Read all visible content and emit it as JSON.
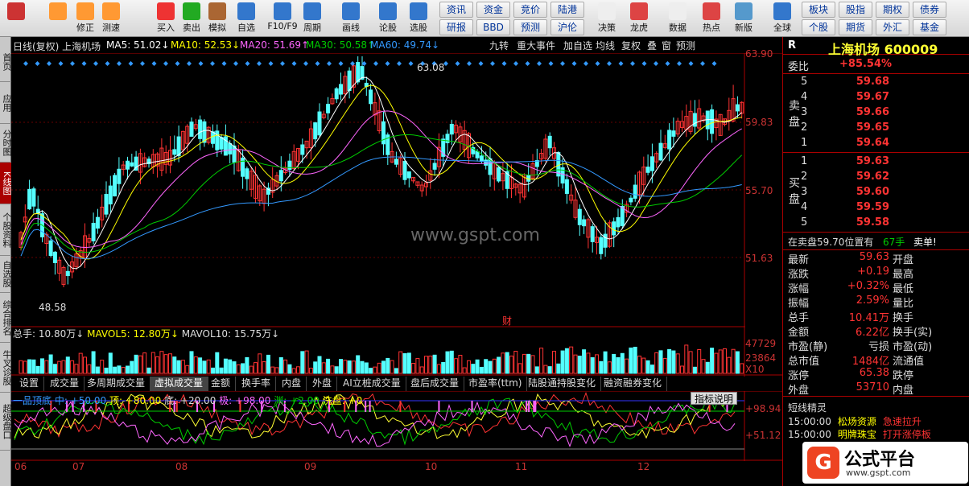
{
  "toolbar": {
    "left_buttons": [
      {
        "label": "",
        "icon": "grid-icon"
      },
      {
        "label": "",
        "icon": "back-arrow-icon"
      },
      {
        "label": "修正",
        "icon": "up-arrow-icon"
      },
      {
        "label": "测速",
        "icon": "smile-icon"
      },
      {
        "label": "买入",
        "icon": "buy-icon"
      },
      {
        "label": "卖出",
        "icon": "sell-icon"
      },
      {
        "label": "模拟",
        "icon": "hammer-icon"
      },
      {
        "label": "自选",
        "icon": "house-icon"
      },
      {
        "label": "F10/F9",
        "icon": "f10-icon"
      },
      {
        "label": "周期",
        "icon": "clock-icon"
      },
      {
        "label": "画线",
        "icon": "pencil-icon"
      },
      {
        "label": "论股",
        "icon": "chat-icon"
      },
      {
        "label": "选股",
        "icon": "chart-icon"
      }
    ],
    "grid1": [
      [
        "资讯",
        "资金",
        "竞价",
        "陆港"
      ],
      [
        "研报",
        "BBD",
        "预测",
        "沪伦"
      ]
    ],
    "mid_buttons": [
      {
        "label": "决策",
        "icon": "decision-icon"
      },
      {
        "label": "龙虎",
        "icon": "dragon-icon"
      },
      {
        "label": "数据",
        "icon": "pe-icon"
      },
      {
        "label": "热点",
        "icon": "hot-icon"
      },
      {
        "label": "新版",
        "icon": "new-icon"
      },
      {
        "label": "全球",
        "icon": "globe-icon"
      }
    ],
    "grid2": [
      [
        "板块",
        "股指",
        "期权",
        "债券"
      ],
      [
        "个股",
        "期货",
        "外汇",
        "基金"
      ]
    ]
  },
  "left_tabs": [
    "首页",
    "应用",
    "分时图",
    "K线图",
    "个股资料",
    "自选股",
    "综合排名",
    "牛叉诊股",
    "超级盘口"
  ],
  "chart_header": {
    "title": "日线(复权) 上海机场",
    "ma5": "MA5: 51.02↓",
    "ma10": "MA10: 52.53↓",
    "ma20": "MA20: 51.69↑",
    "ma30": "MA30: 50.58↑",
    "ma60": "MA60: 49.74↓",
    "right_buttons": [
      "九转",
      "重大事件",
      "加自选",
      "均线",
      "复权",
      "叠",
      "窗",
      "预测"
    ]
  },
  "price_axis": [
    "63.90",
    "59.83",
    "55.70",
    "51.63"
  ],
  "annotations": {
    "high": "63.08",
    "low": "48.58",
    "fin": "财"
  },
  "watermark": "www.gspt.com",
  "volume": {
    "text1": "总手: 10.80万↓",
    "text2": "MAVOL5: 12.80万↓",
    "text3": "MAVOL10: 15.75万↓",
    "axis": [
      "47729",
      "23864",
      "X10"
    ]
  },
  "indicator_tabs": [
    "设置",
    "成交量",
    "多周期成交量",
    "虚拟成交量",
    "金额",
    "换手率",
    "内盘",
    "外盘",
    "AI立桩成交量",
    "盘后成交量",
    "市盈率(ttm)",
    "陆股通持股变化",
    "融资融券变化"
  ],
  "indicator": {
    "name": "一品顶底",
    "t1": "中: +50.00",
    "t2": "顶: +80.00",
    "t3": "底: +20.00",
    "t4": "极: +98.00",
    "t5": "渊: +2.00",
    "t6": "洗盘: +0",
    "help": "指标说明",
    "axis": [
      "+98.94",
      "+51.12"
    ]
  },
  "x_axis": [
    "06",
    "07",
    "08",
    "09",
    "10",
    "11",
    "12"
  ],
  "panel": {
    "r": "R",
    "name": "上海机场 600009",
    "weibi_label": "委比",
    "weibi": "+85.54%",
    "sell_label": "卖盘",
    "buy_label": "买盘",
    "sell": [
      {
        "lv": "5",
        "p": "59.68"
      },
      {
        "lv": "4",
        "p": "59.67"
      },
      {
        "lv": "3",
        "p": "59.66"
      },
      {
        "lv": "2",
        "p": "59.65"
      },
      {
        "lv": "1",
        "p": "59.64"
      }
    ],
    "buy": [
      {
        "lv": "1",
        "p": "59.63"
      },
      {
        "lv": "2",
        "p": "59.62"
      },
      {
        "lv": "3",
        "p": "59.60"
      },
      {
        "lv": "4",
        "p": "59.59"
      },
      {
        "lv": "5",
        "p": "59.58"
      }
    ],
    "tick": "在卖盘59.70位置有",
    "tick_hand": "67手",
    "tick_side": "卖单!",
    "quotes": [
      {
        "k": "最新",
        "v": "59.63",
        "k2": "开盘"
      },
      {
        "k": "涨跌",
        "v": "+0.19",
        "k2": "最高"
      },
      {
        "k": "涨幅",
        "v": "+0.32%",
        "k2": "最低"
      },
      {
        "k": "振幅",
        "v": "2.59%",
        "k2": "量比"
      },
      {
        "k": "总手",
        "v": "10.41万",
        "k2": "换手"
      },
      {
        "k": "金额",
        "v": "6.22亿",
        "k2": "换手(实)"
      },
      {
        "k": "市盈(静)",
        "v": "亏损",
        "k2": "市盈(动)"
      },
      {
        "k": "总市值",
        "v": "1484亿",
        "k2": "流通值"
      },
      {
        "k": "涨停",
        "v": "65.38",
        "k2": "跌停"
      },
      {
        "k": "外盘",
        "v": "53710",
        "k2": "内盘"
      }
    ],
    "fx_title": "短线精灵",
    "fx": [
      {
        "t": "15:00:00",
        "n": "松炀资源",
        "e": "急速拉升"
      },
      {
        "t": "15:00:00",
        "n": "明牌珠宝",
        "e": "打开涨停板"
      }
    ],
    "gspt_name": "公式平台",
    "gspt_url": "www.gspt.com"
  },
  "colors": {
    "up": "#ff3333",
    "down": "#54ffff",
    "ma5": "#ffffff",
    "ma10": "#ffff00",
    "ma20": "#ff66ff",
    "ma30": "#00cc00",
    "ma60": "#3399ff"
  }
}
